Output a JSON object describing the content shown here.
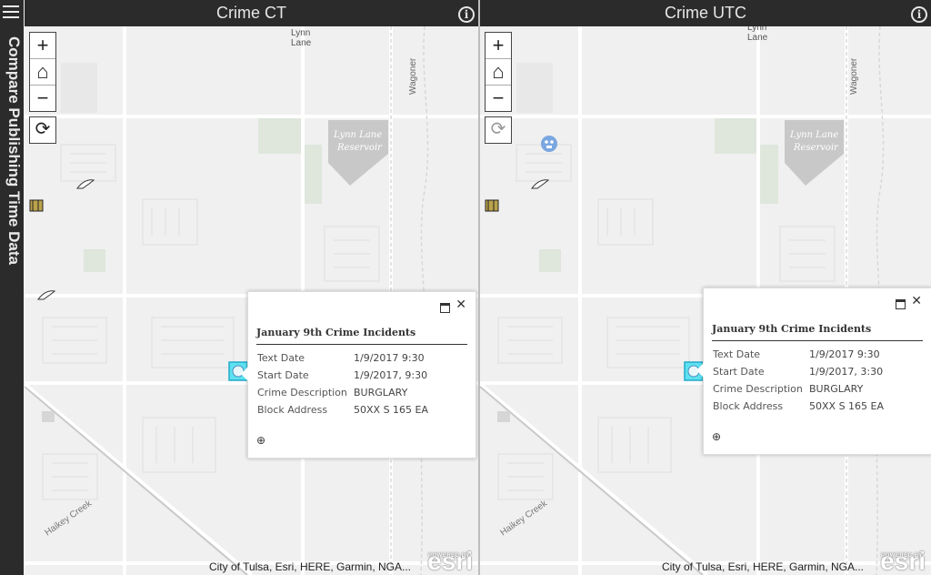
{
  "app": {
    "title": "Compare Publishing Time Data",
    "menu_icon": "hamburger-icon"
  },
  "panes": [
    {
      "title": "Crime CT",
      "popup": {
        "title": "January 9th Crime Incidents",
        "rows": [
          {
            "key": "Text Date",
            "value": "1/9/2017 9:30"
          },
          {
            "key": "Start Date",
            "value": "1/9/2017, 9:30"
          },
          {
            "key": "Crime Description",
            "value": "BURGLARY"
          },
          {
            "key": "Block Address",
            "value": "50XX S 165 EA"
          }
        ]
      }
    },
    {
      "title": "Crime UTC",
      "popup": {
        "title": "January 9th Crime Incidents",
        "rows": [
          {
            "key": "Text Date",
            "value": "1/9/2017 9:30"
          },
          {
            "key": "Start Date",
            "value": "1/9/2017, 3:30"
          },
          {
            "key": "Crime Description",
            "value": "BURGLARY"
          },
          {
            "key": "Block Address",
            "value": "50XX S 165 EA"
          }
        ]
      }
    }
  ],
  "map_labels": {
    "lynn_lane": [
      "Lynn",
      "Lane"
    ],
    "reservoir": [
      "Lynn Lane",
      "Reservoir"
    ],
    "wagoner": "Wagoner",
    "creek": "Haikey Creek"
  },
  "attribution": "City of Tulsa, Esri, HERE, Garmin, NGA...",
  "esri_logo": {
    "powered_by": "POWERED BY",
    "name": "esri"
  },
  "controls": {
    "zoom_in": "+",
    "home": "⌂",
    "zoom_out": "−",
    "refresh": "⟳",
    "info": "i",
    "maximize": "",
    "close": "✕",
    "zoom_to": "⊕"
  }
}
